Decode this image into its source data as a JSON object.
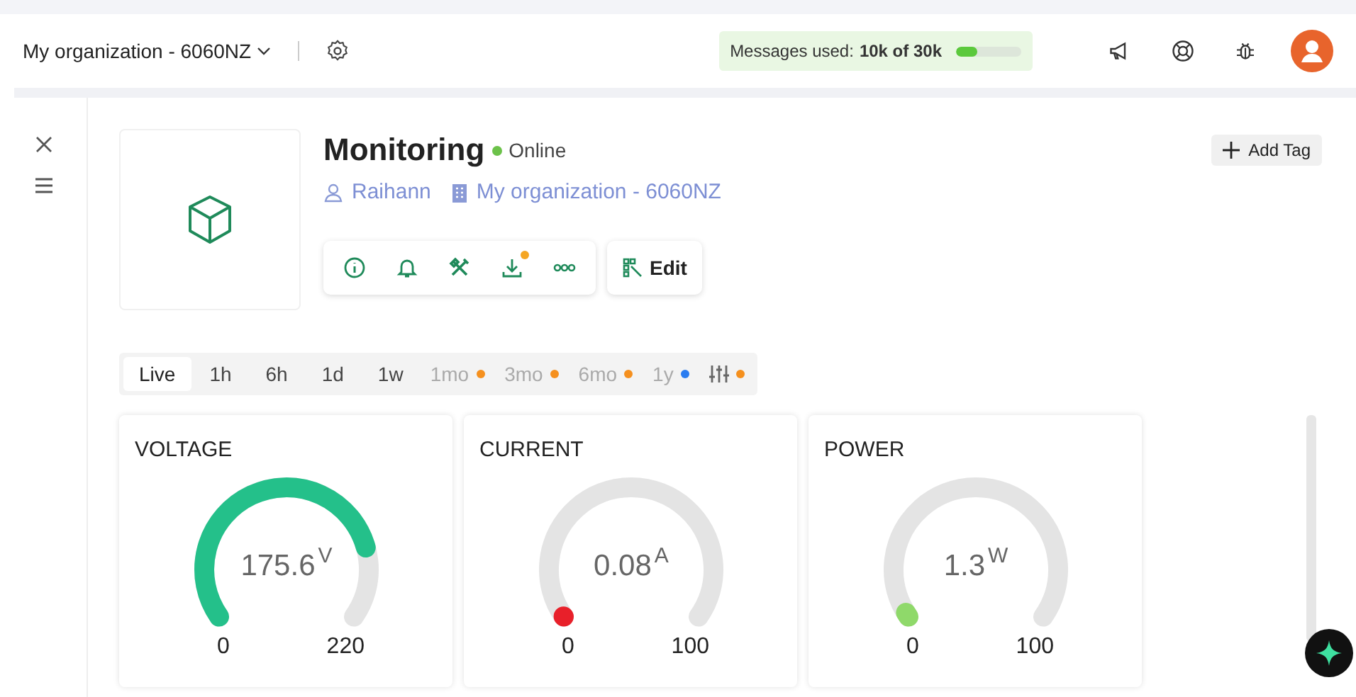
{
  "topbar": {
    "organization": "My organization - 6060NZ",
    "messages": {
      "label": "Messages used:",
      "value": "10k of 30k",
      "level": 0.33
    }
  },
  "device": {
    "title": "Monitoring",
    "status": "Online",
    "online": true,
    "owner": "Raihann",
    "organization": "My organization - 6060NZ",
    "download_badge": true,
    "edit_label": "Edit",
    "add_tag": "Add Tag"
  },
  "ranges": [
    {
      "kind": "text",
      "label": "Live",
      "selected": true,
      "disabled": false
    },
    {
      "kind": "text",
      "label": "1h",
      "selected": false,
      "disabled": false
    },
    {
      "kind": "text",
      "label": "6h",
      "selected": false,
      "disabled": false
    },
    {
      "kind": "text",
      "label": "1d",
      "selected": false,
      "disabled": false
    },
    {
      "kind": "text",
      "label": "1w",
      "selected": false,
      "disabled": false
    },
    {
      "kind": "text",
      "label": "1mo",
      "selected": false,
      "disabled": true,
      "color": "#f5901e"
    },
    {
      "kind": "text",
      "label": "3mo",
      "selected": false,
      "disabled": true,
      "color": "#f5901e"
    },
    {
      "kind": "text",
      "label": "6mo",
      "selected": false,
      "disabled": true,
      "color": "#f5901e"
    },
    {
      "kind": "text",
      "label": "1y",
      "selected": false,
      "disabled": true,
      "color": "#2a7cf0"
    },
    {
      "kind": "icon",
      "selected": false,
      "disabled": true,
      "color": "#f5901e"
    }
  ],
  "gauges": [
    {
      "title": "VOLTAGE",
      "value": "175.6",
      "unit": "V",
      "min": "0",
      "max": "220",
      "color": "#24c08a"
    },
    {
      "title": "CURRENT",
      "value": "0.08",
      "unit": "A",
      "min": "0",
      "max": "100",
      "color": "#e8202a"
    },
    {
      "title": "POWER",
      "value": "1.3",
      "unit": "W",
      "min": "0",
      "max": "100",
      "color": "#8fd96a"
    }
  ]
}
